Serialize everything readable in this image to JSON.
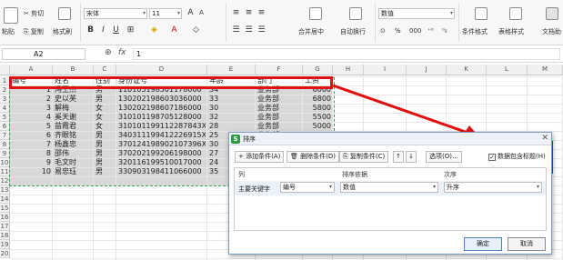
{
  "ribbon": {
    "paste_label": "粘贴",
    "cut_label": "剪切",
    "copy_label": "复制",
    "format_painter_label": "格式刷",
    "font_name": "宋体",
    "font_size": "11",
    "merge_center_label": "合并居中",
    "wrap_label": "自动换行",
    "number_format": "数值",
    "percent_label": "%",
    "thousands_label": "000",
    "conditional_format_label": "条件格式",
    "table_style_label": "表格样式",
    "doc_assistant_label": "文档助",
    "bold": "B",
    "italic": "I",
    "underline": "U"
  },
  "formula_bar": {
    "name_box": "A2",
    "fx_label": "fx",
    "value": "1"
  },
  "columns": [
    "A",
    "B",
    "C",
    "D",
    "E",
    "F",
    "G",
    "H",
    "I",
    "J",
    "K",
    "L",
    "M"
  ],
  "rows": [
    "1",
    "2",
    "3",
    "4",
    "5",
    "6",
    "7",
    "8",
    "9",
    "10",
    "11",
    "12",
    "13",
    "14",
    "15",
    "16",
    "17",
    "18",
    "19",
    "20"
  ],
  "sheet": {
    "headers": [
      "编号",
      "姓名",
      "性别",
      "身份证号",
      "年龄",
      "部门",
      "工资"
    ],
    "rows": [
      [
        "1",
        "冯王杰",
        "男",
        "110105198501178000",
        "34",
        "业务部",
        "6000"
      ],
      [
        "2",
        "史以芙",
        "男",
        "130202198603036000",
        "33",
        "业务部",
        "6800"
      ],
      [
        "3",
        "解梅",
        "女",
        "130202198607186000",
        "30",
        "业务部",
        "5800"
      ],
      [
        "4",
        "奚天谢",
        "女",
        "310101198705128000",
        "32",
        "业务部",
        "5500"
      ],
      [
        "5",
        "苗霞君",
        "女",
        "310101199112287843X",
        "28",
        "业务部",
        "5000"
      ],
      [
        "6",
        "齐眼铭",
        "男",
        "340311199412226915X",
        "25",
        "业务部",
        "4800"
      ],
      [
        "7",
        "杨鑫忠",
        "男",
        "370124198902107396X",
        "30",
        "业务部",
        "5000"
      ],
      [
        "8",
        "邵伟",
        "男",
        "370202199206198000",
        "27",
        "业务部",
        "4600"
      ],
      [
        "9",
        "毛文时",
        "男",
        "320116199510017000",
        "24",
        "业务部",
        "4500"
      ],
      [
        "10",
        "易忠珏",
        "男",
        "330903198411066000",
        "35",
        "业务部",
        "5200"
      ]
    ]
  },
  "dialog": {
    "title": "排序",
    "add_condition": "添加条件(A)",
    "delete_condition": "删除条件(D)",
    "copy_condition": "复制条件(C)",
    "up": "↑",
    "down": "↓",
    "options": "选项(O)...",
    "header_checkbox_label": "数据包含标题(H)",
    "header_checkbox_checked": true,
    "col_header_column": "列",
    "col_header_sortby": "排序依据",
    "col_header_order": "次序",
    "row_key_label": "主要关键字",
    "row_key_value": "编号",
    "row_sortby_value": "数值",
    "row_order_value": "升序",
    "ok_label": "确定",
    "cancel_label": "取消"
  },
  "colors": {
    "highlight_red": "#e01010",
    "highlight_green": "#2fa84f"
  }
}
